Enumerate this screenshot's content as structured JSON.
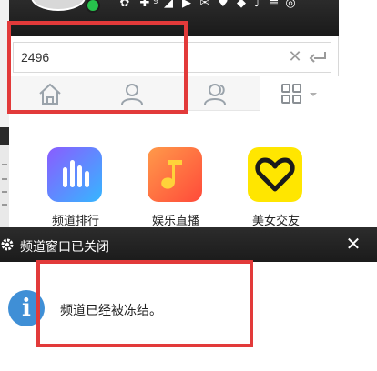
{
  "search": {
    "value": "2496",
    "clear_icon": "close-icon",
    "enter_icon": "enter-icon"
  },
  "tabs": [
    {
      "name": "home",
      "icon": "home-icon"
    },
    {
      "name": "contact",
      "icon": "contact-icon"
    },
    {
      "name": "group",
      "icon": "group-icon"
    },
    {
      "name": "apps",
      "icon": "grid-icon"
    }
  ],
  "apps": [
    {
      "label": "频道排行",
      "icon": "bar-chart-icon",
      "color_top": "#7a6cff",
      "color_bottom": "#2fb8ff"
    },
    {
      "label": "娱乐直播",
      "icon": "music-note-icon",
      "color_top": "#ff8a4a",
      "color_bottom": "#ff4d3c"
    },
    {
      "label": "美女交友",
      "icon": "heart-icon",
      "color_top": "#ffe600",
      "color_bottom": "#ffd000"
    }
  ],
  "topbar": {
    "badge_count": "9"
  },
  "popup": {
    "title": "频道窗口已关闭",
    "message": "频道已经被冻结。",
    "close_label": "✕"
  },
  "colors": {
    "annotation_red": "#e23a3a",
    "info_blue": "#3f8fd6",
    "online_green": "#27c24c",
    "dark_bar": "#1b1b1b"
  }
}
